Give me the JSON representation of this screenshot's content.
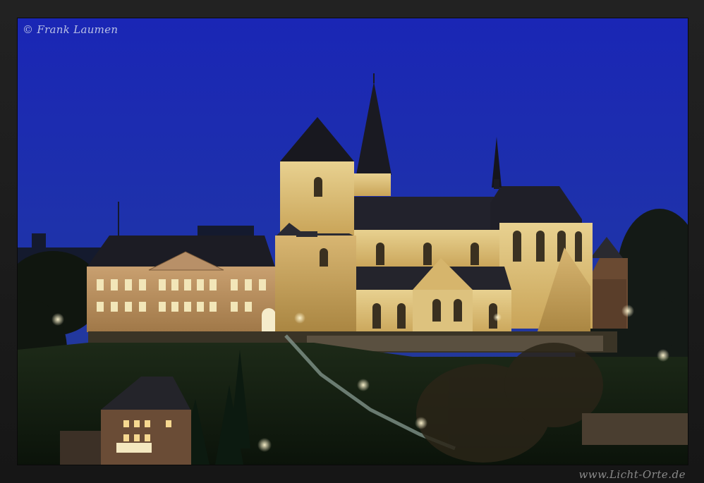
{
  "watermark": {
    "copyright": "© Frank Laumen",
    "website": "www.Licht-Orte.de"
  },
  "colors": {
    "frame": "#1a1a1a",
    "sky_top": "#1e2bb8",
    "sky_bottom": "#233c92",
    "lit_stone": "#e6c77a",
    "roof": "#1d1d26"
  }
}
